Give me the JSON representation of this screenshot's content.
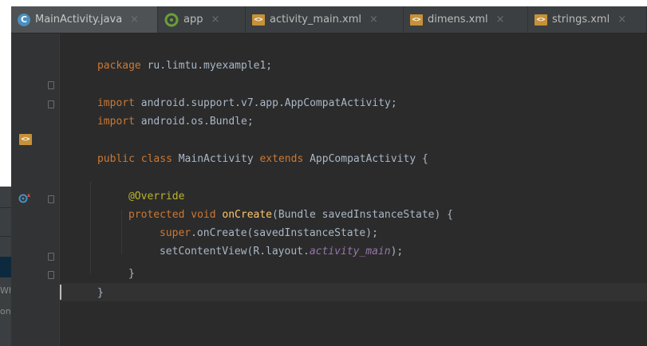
{
  "tabs": [
    {
      "label": "MainActivity.java",
      "icon": "java-class-icon",
      "active": true
    },
    {
      "label": "app",
      "icon": "gradle-icon",
      "active": false
    },
    {
      "label": "activity_main.xml",
      "icon": "xml-icon",
      "active": false
    },
    {
      "label": "dimens.xml",
      "icon": "xml-icon",
      "active": false
    },
    {
      "label": "strings.xml",
      "icon": "xml-icon",
      "active": false
    }
  ],
  "tab_close_glyph": "×",
  "background_window": {
    "visible_text": [
      "Wh",
      "on"
    ]
  },
  "code": {
    "line1": {
      "kw": "package",
      "rest": " ru.limtu.myexample1;"
    },
    "line3": {
      "kw": "import",
      "rest": " android.support.v7.app.AppCompatActivity;"
    },
    "line4": {
      "kw": "import",
      "rest": " android.os.Bundle;"
    },
    "line6": {
      "kw1": "public",
      "kw2": "class",
      "name": " MainActivity ",
      "kw3": "extends",
      "rest": " AppCompatActivity {"
    },
    "line8": {
      "annotation": "@Override"
    },
    "line9": {
      "kw1": "protected",
      "kw2": "void",
      "method": "onCreate",
      "rest": "(Bundle savedInstanceState) {"
    },
    "line10": {
      "kw": "super",
      "rest": ".onCreate(savedInstanceState);"
    },
    "line11": {
      "pre": "setContentView(R.layout.",
      "field": "activity_main",
      "post": ");"
    },
    "line12": {
      "text": "}"
    },
    "line13": {
      "text": "}"
    }
  },
  "colors": {
    "keyword": "#cc7832",
    "annotation": "#bbb529",
    "method": "#ffc66d",
    "field": "#9876aa",
    "text": "#a9b7c6",
    "editor_bg": "#2b2b2b",
    "gutter_bg": "#313335",
    "tab_bar_bg": "#3c3f41"
  }
}
